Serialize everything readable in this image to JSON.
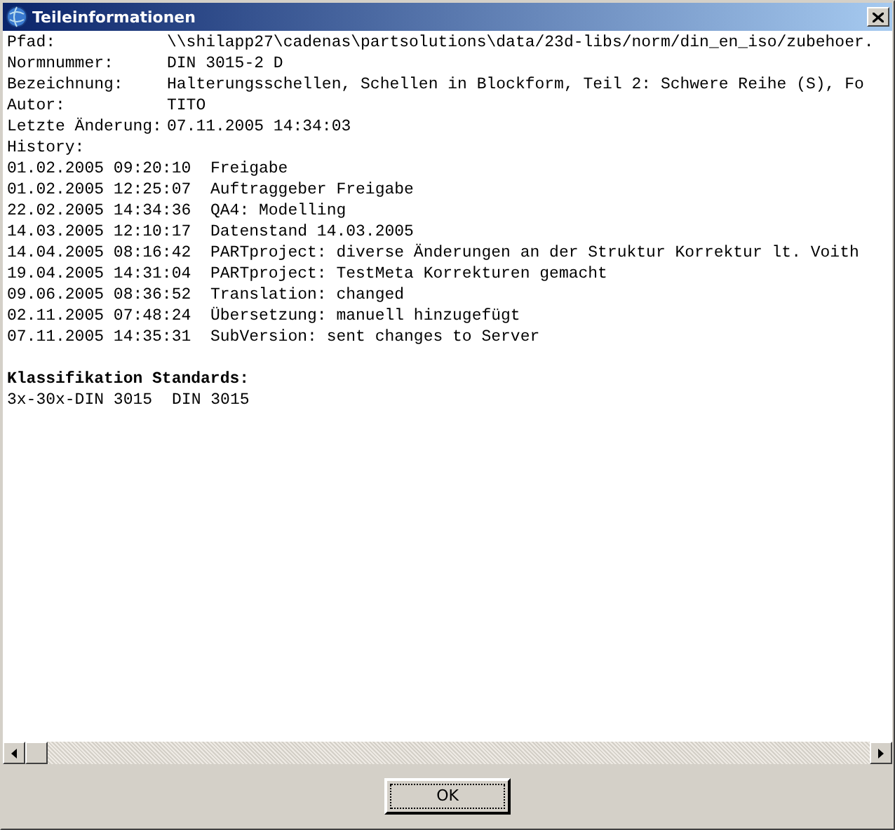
{
  "window": {
    "title": "Teileinformationen"
  },
  "fields": [
    {
      "label": "Pfad:",
      "value": "\\\\shilapp27\\cadenas\\partsolutions\\data/23d-libs/norm/din_en_iso/zubehoer."
    },
    {
      "label": "Normnummer:",
      "value": "DIN 3015-2 D"
    },
    {
      "label": "Bezeichnung:",
      "value": "Halterungsschellen, Schellen in Blockform, Teil 2: Schwere Reihe (S), Fo"
    },
    {
      "label": "Autor:",
      "value": "TITO"
    },
    {
      "label": "Letzte Änderung:",
      "value": "07.11.2005 14:34:03"
    }
  ],
  "history_label": "History:",
  "history": [
    {
      "timestamp": "01.02.2005 09:20:10",
      "text": "Freigabe"
    },
    {
      "timestamp": "01.02.2005 12:25:07",
      "text": "Auftraggeber Freigabe"
    },
    {
      "timestamp": "22.02.2005 14:34:36",
      "text": "QA4: Modelling"
    },
    {
      "timestamp": "14.03.2005 12:10:17",
      "text": "Datenstand 14.03.2005"
    },
    {
      "timestamp": "14.04.2005 08:16:42",
      "text": "PARTproject: diverse Änderungen an der Struktur Korrektur lt. Voith"
    },
    {
      "timestamp": "19.04.2005 14:31:04",
      "text": "PARTproject: TestMeta Korrekturen gemacht"
    },
    {
      "timestamp": "09.06.2005 08:36:52",
      "text": "Translation: changed"
    },
    {
      "timestamp": "02.11.2005 07:48:24",
      "text": "Übersetzung: manuell hinzugefügt"
    },
    {
      "timestamp": "07.11.2005 14:35:31",
      "text": "SubVersion: sent changes to Server"
    }
  ],
  "classification": {
    "heading": "Klassifikation Standards:",
    "entries": [
      "3x-30x-DIN 3015",
      "DIN 3015"
    ]
  },
  "buttons": [
    "OK"
  ]
}
